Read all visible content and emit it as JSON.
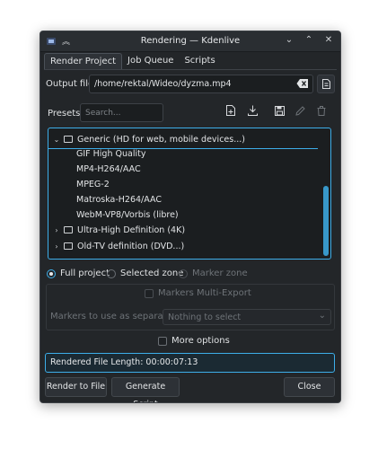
{
  "window": {
    "title": "Rendering — Kdenlive",
    "controls": {
      "minimize": "⌄",
      "maximize": "⌃",
      "close": "✕"
    }
  },
  "tabs": [
    {
      "label": "Render Project",
      "active": true
    },
    {
      "label": "Job Queue",
      "active": false
    },
    {
      "label": "Scripts",
      "active": false
    }
  ],
  "output": {
    "label": "Output file",
    "value": "/home/rektal/Wideo/dyzma.mp4"
  },
  "presets": {
    "label": "Presets",
    "search_placeholder": "Search...",
    "toolbar_icons": [
      "new-preset-icon",
      "download-icon",
      "save-preset-icon",
      "edit-icon",
      "delete-icon"
    ]
  },
  "tree": {
    "groups": [
      {
        "label": "Generic (HD for web, mobile devices...)",
        "expanded": true,
        "items": [
          "GIF High Quality",
          "MP4-H264/AAC",
          "MPEG-2",
          "Matroska-H264/AAC",
          "WebM-VP8/Vorbis (libre)"
        ]
      },
      {
        "label": "Ultra-High Definition (4K)",
        "expanded": false,
        "items": []
      },
      {
        "label": "Old-TV definition (DVD...)",
        "expanded": false,
        "items": []
      }
    ]
  },
  "range": {
    "full": "Full project",
    "selected": "Selected zone",
    "marker": "Marker zone"
  },
  "markers": {
    "multi_export": "Markers Multi-Export",
    "separator_label": "Markers to use as separator:",
    "separator_value": "Nothing to select"
  },
  "more_options": "More options",
  "status": "Rendered File Length: 00:00:07:13",
  "buttons": {
    "render": "Render to File",
    "script": "Generate Script",
    "close": "Close"
  },
  "colors": {
    "accent": "#3daee9",
    "window_bg": "#232629"
  }
}
